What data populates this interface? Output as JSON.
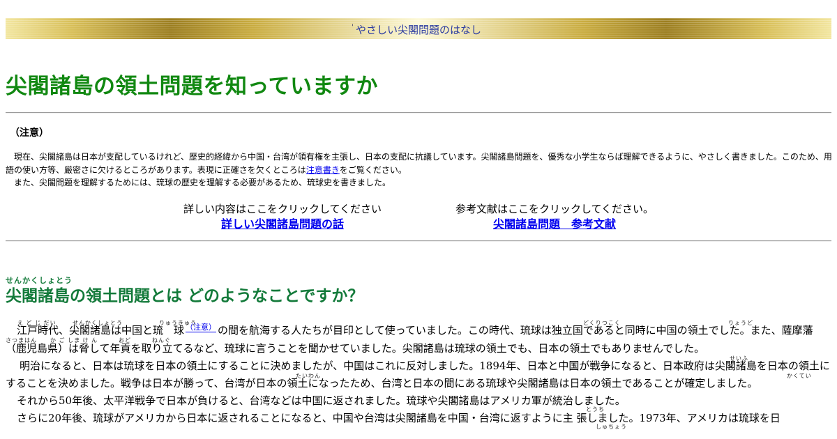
{
  "banner": {
    "dot": "'",
    "link": "やさしい尖閣問題のはなし"
  },
  "title": "尖閣諸島の領土問題を知っていますか",
  "notice": {
    "heading": "（注意）",
    "p1_before": "現在、尖閣諸島は日本が支配しているけれど、歴史的経緯から中国・台湾が領有権を主張し、日本の支配に抗議しています。尖閣諸島問題を、優秀な小学生ならば理解できるように、やさしく書きました。このため、用語の使い方等、厳密さに欠けるところがあります。表現に正確さを欠くところは",
    "p1_link": "注意書き",
    "p1_after": "をご覧ください。",
    "p2": "また、尖閣問題を理解するためには、琉球の歴史を理解する必要があるため、琉球史を書きました。"
  },
  "links": {
    "detail_label": "詳しい内容はここをクリックしてください",
    "detail_link": "詳しい尖閣諸島問題の話",
    "ref_label": "参考文献はここをクリックしてください。",
    "ref_link": "尖閣諸島問題　参考文献"
  },
  "section": {
    "ruby": "せんかくしょとう",
    "title": "尖閣諸島の領土問題とは どのようなことですか？"
  },
  "ruby": {
    "edo": "え ど じ だい",
    "senkaku": "せんかくしょとう",
    "ryukyu": "りゅうきゅう",
    "dokuritsu": "どくりつこく",
    "ryodo": "りょうど",
    "satsuma": "さつまはん",
    "kagoshima": "か ご しま け ん",
    "odo": "おど",
    "nengu": "ねんぐ",
    "seifu": "せいふ",
    "taiwan": "たいわん",
    "kakutei": "かくてい",
    "tochi": "とうち",
    "shucho": "しゅちょう"
  },
  "body": {
    "p1_a": "江戸時代、尖閣諸島は中国と琉　球",
    "p1_note": "（注意）",
    "p1_b": "の間を航海する人たちが目印として使っていました。この時代、琉球は独立国であると同時に中国の領土でした。また、薩摩藩（鹿児島県）は脅して年貢を取り立てるなど、琉球に言うことを聞かせていました。尖閣諸島は琉球の領土でも、日本の領土でもありませんでした。",
    "p2": "明治になると、日本は琉球を日本の領土にすることに決めましたが、中国はこれに反対しました。1894年、日本と中国が戦争になると、日本政府は尖閣諸島を日本の領土にすることを決めました。戦争は日本が勝って、台湾が日本の領土になったため、台湾と日本の間にある琉球や尖閣諸島は日本の領土であることが確定しました。",
    "p3": "それから50年後、太平洋戦争で日本が負けると、台湾などは中国に返されました。琉球や尖閣諸島はアメリカ軍が統治しました。",
    "p4": "さらに20年後、琉球がアメリカから日本に返されることになると、中国や台湾は尖閣諸島を中国・台湾に返すように主 張しました。1973年、アメリカは琉球を日"
  }
}
